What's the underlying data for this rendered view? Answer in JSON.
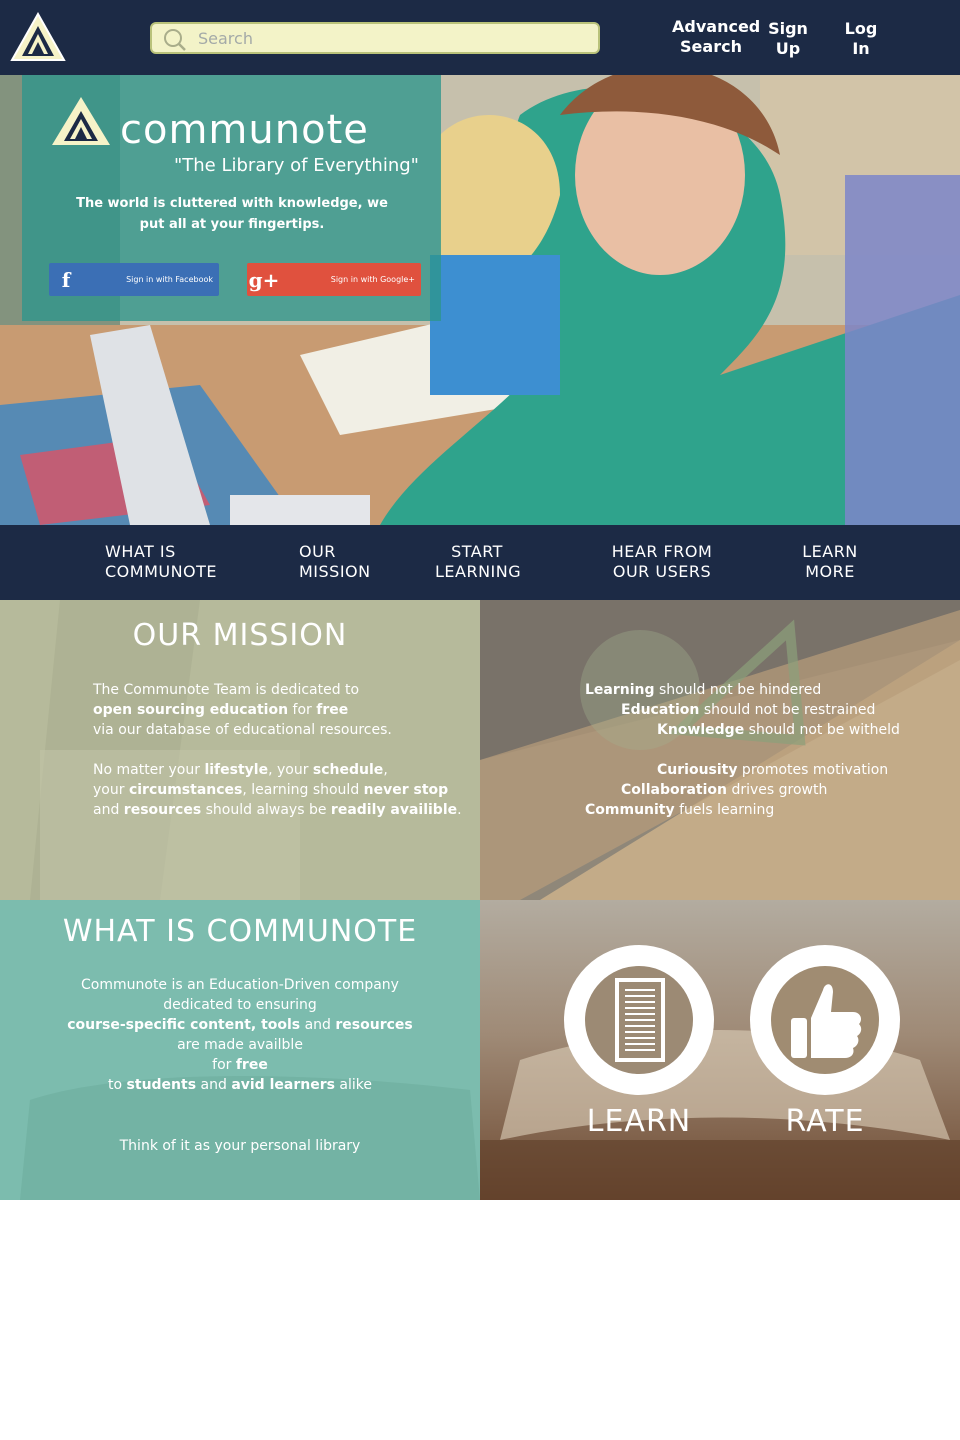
{
  "header": {
    "search_placeholder": "Search",
    "advanced_search_label": "Advanced Search",
    "signup_label": "Sign Up",
    "login_label": "Log In"
  },
  "hero": {
    "brand": "communote",
    "tagline": "\"The Library of Everything\"",
    "blurb": "The world is cluttered with knowledge, we put all at your fingertips.",
    "facebook_icon_text": "f",
    "facebook_label": "Sign in with Facebook",
    "google_icon_text": "g+",
    "google_label": "Sign in with Google+"
  },
  "section_nav": [
    {
      "line1": "WHAT IS",
      "line2": "COMMUNOTE"
    },
    {
      "line1": "OUR",
      "line2": "MISSION"
    },
    {
      "line1": "START",
      "line2": "LEARNING"
    },
    {
      "line1": "HEAR FROM",
      "line2": "OUR USERS"
    },
    {
      "line1": "LEARN",
      "line2": "MORE"
    }
  ],
  "mission": {
    "title": "OUR MISSION",
    "p1": {
      "a": "The Communote Team is dedicated to",
      "b_bold": "open sourcing education",
      "b_rest": " for ",
      "b_bold2": "free",
      "c": "via our database of educational resources."
    },
    "p2": {
      "a1": "No matter your ",
      "a_bold1": "lifestyle",
      "a2": ", your ",
      "a_bold2": "schedule",
      "a3": ",",
      "b1": "your ",
      "b_bold1": "circumstances",
      "b2": ", learning should ",
      "b_bold2": "never stop",
      "c1": "and ",
      "c_bold1": "resources",
      "c2": " should always be ",
      "c_bold2": "readily availible",
      "c3": "."
    },
    "values": [
      {
        "bold": "Learning",
        "rest": " should not be hindered"
      },
      {
        "bold": "Education",
        "rest": " should not be restrained"
      },
      {
        "bold": "Knowledge",
        "rest": " should not be witheld"
      },
      {
        "bold": "Curiousity",
        "rest": " promotes motivation"
      },
      {
        "bold": "Collaboration",
        "rest": " drives growth"
      },
      {
        "bold": "Community",
        "rest": " fuels learning"
      }
    ]
  },
  "what_is": {
    "title": "WHAT IS COMMUNOTE",
    "l1": "Communote is an Education-Driven company",
    "l2": "dedicated to ensuring",
    "l3_bold1": "course-specific content, tools",
    "l3_mid": " and ",
    "l3_bold2": "resources",
    "l4": "are made availble",
    "l5_a": "for ",
    "l5_bold": "free",
    "l6_a": "to ",
    "l6_bold1": "students",
    "l6_mid": " and ",
    "l6_bold2": "avid learners",
    "l6_end": " alike",
    "footer": "Think of it as your personal library"
  },
  "actions": {
    "learn_label": "LEARN",
    "rate_label": "RATE"
  },
  "colors": {
    "navy": "#1c2a45",
    "teal_overlay": "#2d968c",
    "search_bg": "#f3f3c8",
    "facebook": "#3b6fb5",
    "google": "#e0513e"
  }
}
